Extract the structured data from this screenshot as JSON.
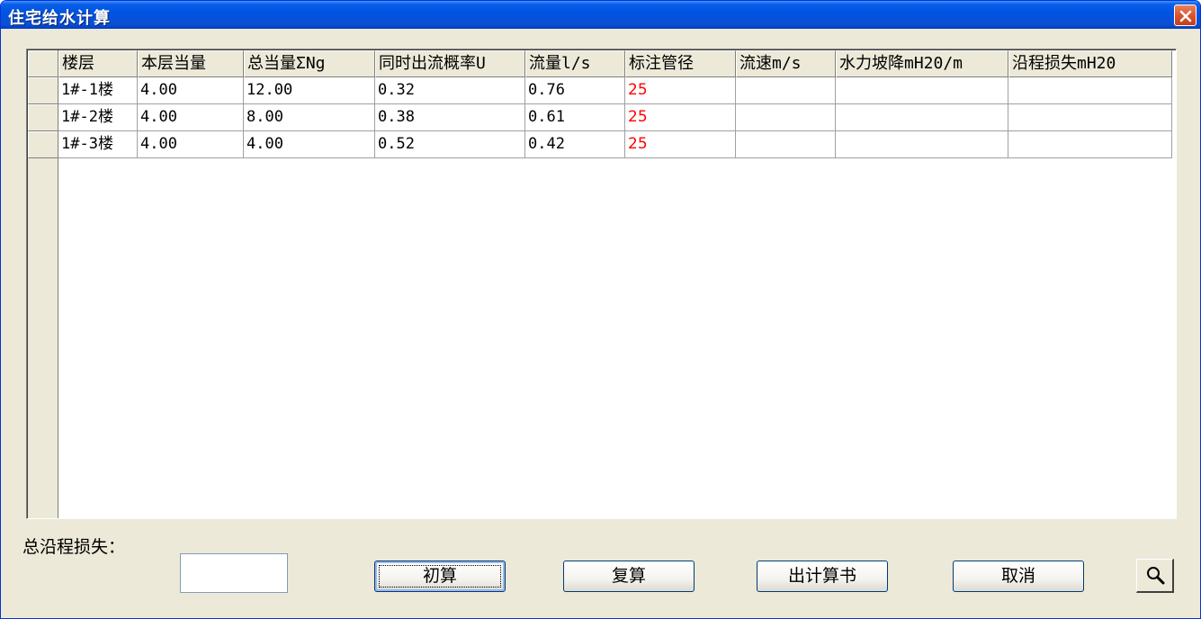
{
  "window": {
    "title": "住宅给水计算",
    "close_icon": "close-icon"
  },
  "table": {
    "columns": [
      "楼层",
      "本层当量",
      "总当量ΣNg",
      "同时出流概率U",
      "流量l/s",
      "标注管径",
      "流速m/s",
      "水力坡降mH20/m",
      "沿程损失mH20"
    ],
    "rows": [
      [
        "1#-1楼",
        "4.00",
        "12.00",
        "0.32",
        "0.76",
        "25",
        "",
        "",
        ""
      ],
      [
        "1#-2楼",
        "4.00",
        "8.00",
        "0.38",
        "0.61",
        "25",
        "",
        "",
        ""
      ],
      [
        "1#-3楼",
        "4.00",
        "4.00",
        "0.52",
        "0.42",
        "25",
        "",
        "",
        ""
      ]
    ]
  },
  "footer": {
    "total_loss_label": "总沿程损失：",
    "total_loss_value": "",
    "buttons": {
      "initial": "初算",
      "recalc": "复算",
      "report": "出计算书",
      "cancel": "取消"
    },
    "zoom_icon": "magnifier-icon"
  },
  "colors": {
    "title_bar": "#0054e3",
    "pipe_size_text": "#ff0000",
    "dialog_bg": "#ece9d8"
  }
}
